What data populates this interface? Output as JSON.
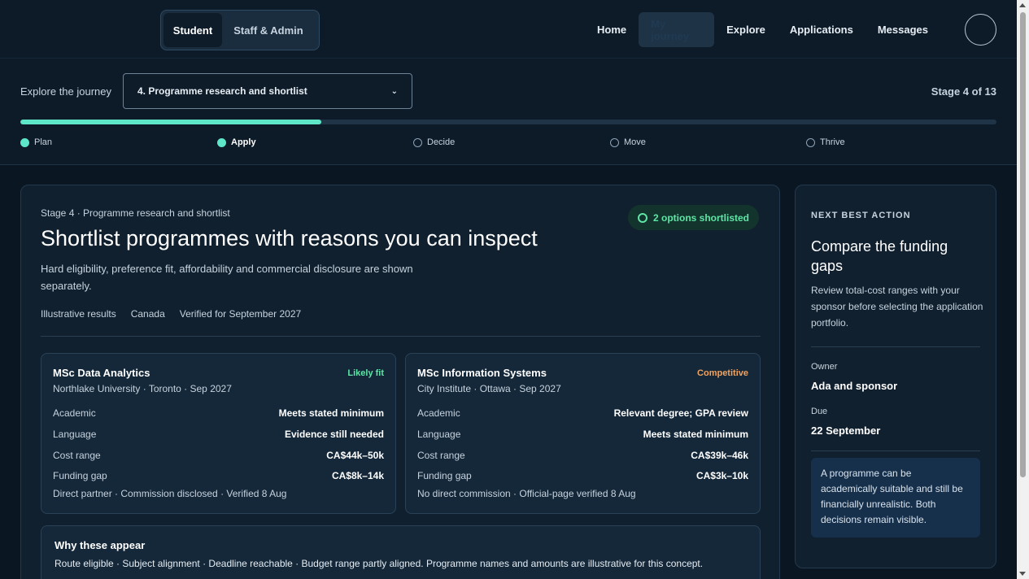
{
  "header": {
    "roles": [
      "Student",
      "Staff & Admin"
    ],
    "active_role": "Student",
    "nav": [
      "Home",
      "My journey",
      "Explore",
      "Applications",
      "Messages"
    ],
    "current_nav": "My journey"
  },
  "journey": {
    "label": "Explore the journey",
    "selected_stage": "4. Programme research and shortlist",
    "stage_count": "Stage 4 of 13",
    "progress_fraction": 0.308,
    "phases": [
      {
        "label": "Plan",
        "state": "done"
      },
      {
        "label": "Apply",
        "state": "active"
      },
      {
        "label": "Decide",
        "state": "todo"
      },
      {
        "label": "Move",
        "state": "todo"
      },
      {
        "label": "Thrive",
        "state": "todo"
      }
    ]
  },
  "main": {
    "kicker": "Stage 4 · Programme research and shortlist",
    "title": "Shortlist programmes with reasons you can inspect",
    "description": "Hard eligibility, preference fit, affordability and commercial disclosure are shown separately.",
    "badge": "2 options shortlisted",
    "meta": [
      "Illustrative results",
      "Canada",
      "Verified for September 2027"
    ],
    "programmes": [
      {
        "name": "MSc Data Analytics",
        "subtitle": "Northlake University · Toronto · Sep 2027",
        "fit": "Likely fit",
        "rows": [
          {
            "k": "Academic",
            "v": "Meets stated minimum"
          },
          {
            "k": "Language",
            "v": "Evidence still needed"
          },
          {
            "k": "Cost range",
            "v": "CA$44k–50k"
          },
          {
            "k": "Funding gap",
            "v": "CA$8k–14k"
          }
        ],
        "footer": "Direct partner · Commission disclosed · Verified 8 Aug"
      },
      {
        "name": "MSc Information Systems",
        "subtitle": "City Institute · Ottawa · Sep 2027",
        "fit": "Competitive",
        "rows": [
          {
            "k": "Academic",
            "v": "Relevant degree; GPA review"
          },
          {
            "k": "Language",
            "v": "Meets stated minimum"
          },
          {
            "k": "Cost range",
            "v": "CA$39k–46k"
          },
          {
            "k": "Funding gap",
            "v": "CA$3k–10k"
          }
        ],
        "footer": "No direct commission · Official-page verified 8 Aug"
      }
    ],
    "why": {
      "title": "Why these appear",
      "text": "Route eligible · Subject alignment · Deadline reachable · Budget range partly aligned. Programme names and amounts are illustrative for this concept."
    }
  },
  "side": {
    "kicker": "NEXT BEST ACTION",
    "title": "Compare the funding gaps",
    "description": "Review total-cost ranges with your sponsor before selecting the application portfolio.",
    "owner_label": "Owner",
    "owner": "Ada and sponsor",
    "due_label": "Due",
    "due": "22 September",
    "note": "A programme can be academically suitable and still be financially unrealistic. Both decisions remain visible."
  },
  "colors": {
    "accent": "#5ee6c8",
    "likely": "#5ee6a6",
    "competitive": "#f2a35e",
    "background": "#0a1622"
  }
}
